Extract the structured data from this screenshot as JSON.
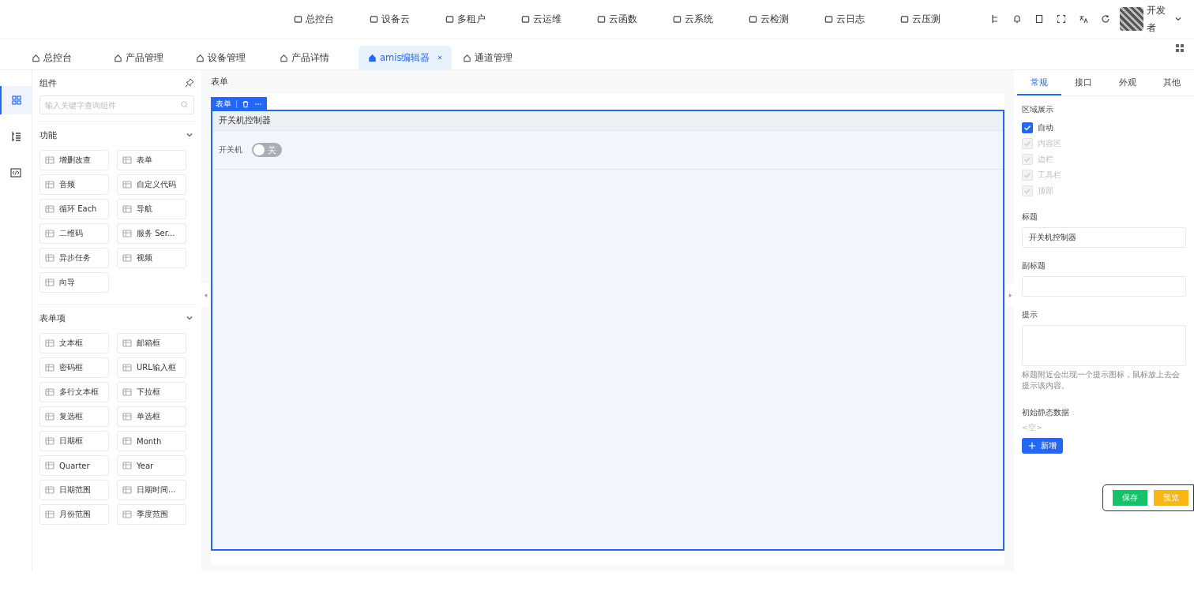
{
  "top_nav": [
    {
      "label": "总控台"
    },
    {
      "label": "设备云"
    },
    {
      "label": "多租户"
    },
    {
      "label": "云运维"
    },
    {
      "label": "云函数"
    },
    {
      "label": "云系统"
    },
    {
      "label": "云检测"
    },
    {
      "label": "云日志"
    },
    {
      "label": "云压测"
    }
  ],
  "user": {
    "name": "开发者"
  },
  "tabs": [
    {
      "label": "总控台",
      "selected": false,
      "closable": false
    },
    {
      "label": "产品管理",
      "selected": false,
      "closable": false
    },
    {
      "label": "设备管理",
      "selected": false,
      "closable": false
    },
    {
      "label": "产品详情",
      "selected": false,
      "closable": false
    },
    {
      "label": "amis编辑器",
      "selected": true,
      "closable": true
    },
    {
      "label": "通道管理",
      "selected": false,
      "closable": false
    }
  ],
  "rail": [
    {
      "selected": true
    },
    {
      "selected": false
    },
    {
      "selected": false
    }
  ],
  "component_panel": {
    "title": "组件",
    "search_placeholder": "输入关键字查询组件",
    "groups": [
      {
        "title": "功能",
        "expanded": true,
        "items": [
          "增删改查",
          "表单",
          "音频",
          "自定义代码",
          "循环 Each",
          "导航",
          "二维码",
          "服务 Ser...",
          "异步任务",
          "视频",
          "向导"
        ]
      },
      {
        "title": "表单项",
        "expanded": true,
        "items": [
          "文本框",
          "邮箱框",
          "密码框",
          "URL输入框",
          "多行文本框",
          "下拉框",
          "复选框",
          "单选框",
          "日期框",
          "Month",
          "Quarter",
          "Year",
          "日期范围",
          "日期时间...",
          "月份范围",
          "季度范围"
        ]
      }
    ]
  },
  "canvas": {
    "breadcrumb": "表单",
    "toolbar_label": "表单",
    "form_title": "开关机控制器",
    "field_label": "开关机",
    "switch": {
      "on": false,
      "text": "关"
    }
  },
  "settings": {
    "tabs": [
      {
        "label": "常规",
        "selected": true
      },
      {
        "label": "接口",
        "selected": false
      },
      {
        "label": "外观",
        "selected": false
      },
      {
        "label": "其他",
        "selected": false
      }
    ],
    "region_label": "区域展示",
    "regions": [
      {
        "label": "自动",
        "checked": true,
        "disabled": false
      },
      {
        "label": "内容区",
        "checked": true,
        "disabled": true
      },
      {
        "label": "边栏",
        "checked": true,
        "disabled": true
      },
      {
        "label": "工具栏",
        "checked": true,
        "disabled": true
      },
      {
        "label": "顶部",
        "checked": true,
        "disabled": true
      }
    ],
    "title_label": "标题",
    "title_value": "开关机控制器",
    "subtitle_label": "副标题",
    "hint_label": "提示",
    "hint_help": "标题附近会出现一个提示图标，鼠标放上去会提示该内容。",
    "data_label": "初始静态数据",
    "data_empty": "<空>",
    "add_button": "新增"
  },
  "actions": {
    "save": "保存",
    "preview": "预览"
  }
}
